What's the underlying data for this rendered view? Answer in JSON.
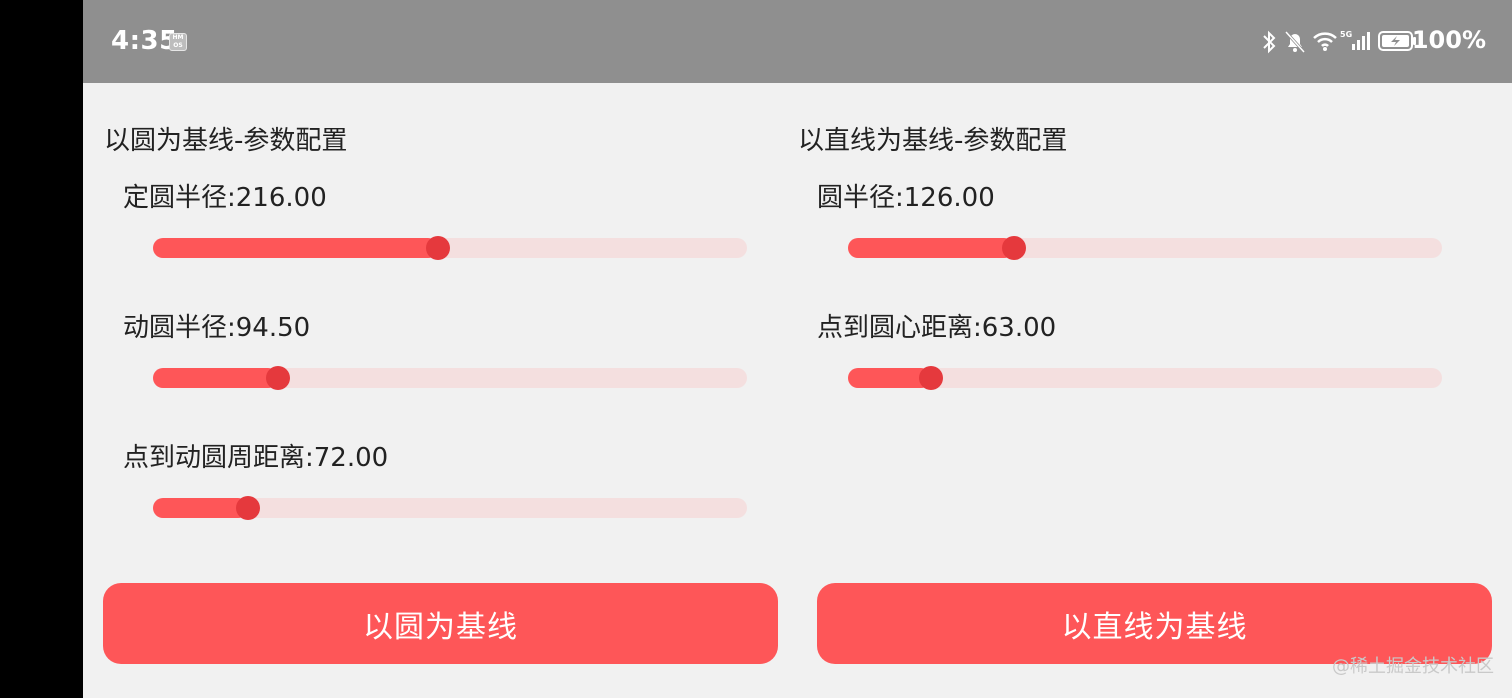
{
  "status_bar": {
    "time": "4:35",
    "battery": "100%",
    "icons": [
      "hmos-badge-icon",
      "bluetooth-icon",
      "bell-muted-icon",
      "wifi-icon",
      "signal-5g-icon",
      "battery-charging-icon"
    ]
  },
  "circle_panel": {
    "title": "以圆为基线-参数配置",
    "params": [
      {
        "label": "定圆半径:216.00",
        "value": 216.0,
        "fraction": 0.48
      },
      {
        "label": "动圆半径:94.50",
        "value": 94.5,
        "fraction": 0.21
      },
      {
        "label": "点到动圆周距离:72.00",
        "value": 72.0,
        "fraction": 0.16
      }
    ],
    "button_label": "以圆为基线"
  },
  "line_panel": {
    "title": "以直线为基线-参数配置",
    "params": [
      {
        "label": "圆半径:126.00",
        "value": 126.0,
        "fraction": 0.28
      },
      {
        "label": "点到圆心距离:63.00",
        "value": 63.0,
        "fraction": 0.14
      }
    ],
    "button_label": "以直线为基线"
  },
  "colors": {
    "accent": "#fe5658",
    "thumb": "#e5393d",
    "track": "#f4dfdf",
    "status_bar": "#8f8f8f",
    "background": "#f1f1f1"
  },
  "watermark": "@稀土掘金技术社区"
}
